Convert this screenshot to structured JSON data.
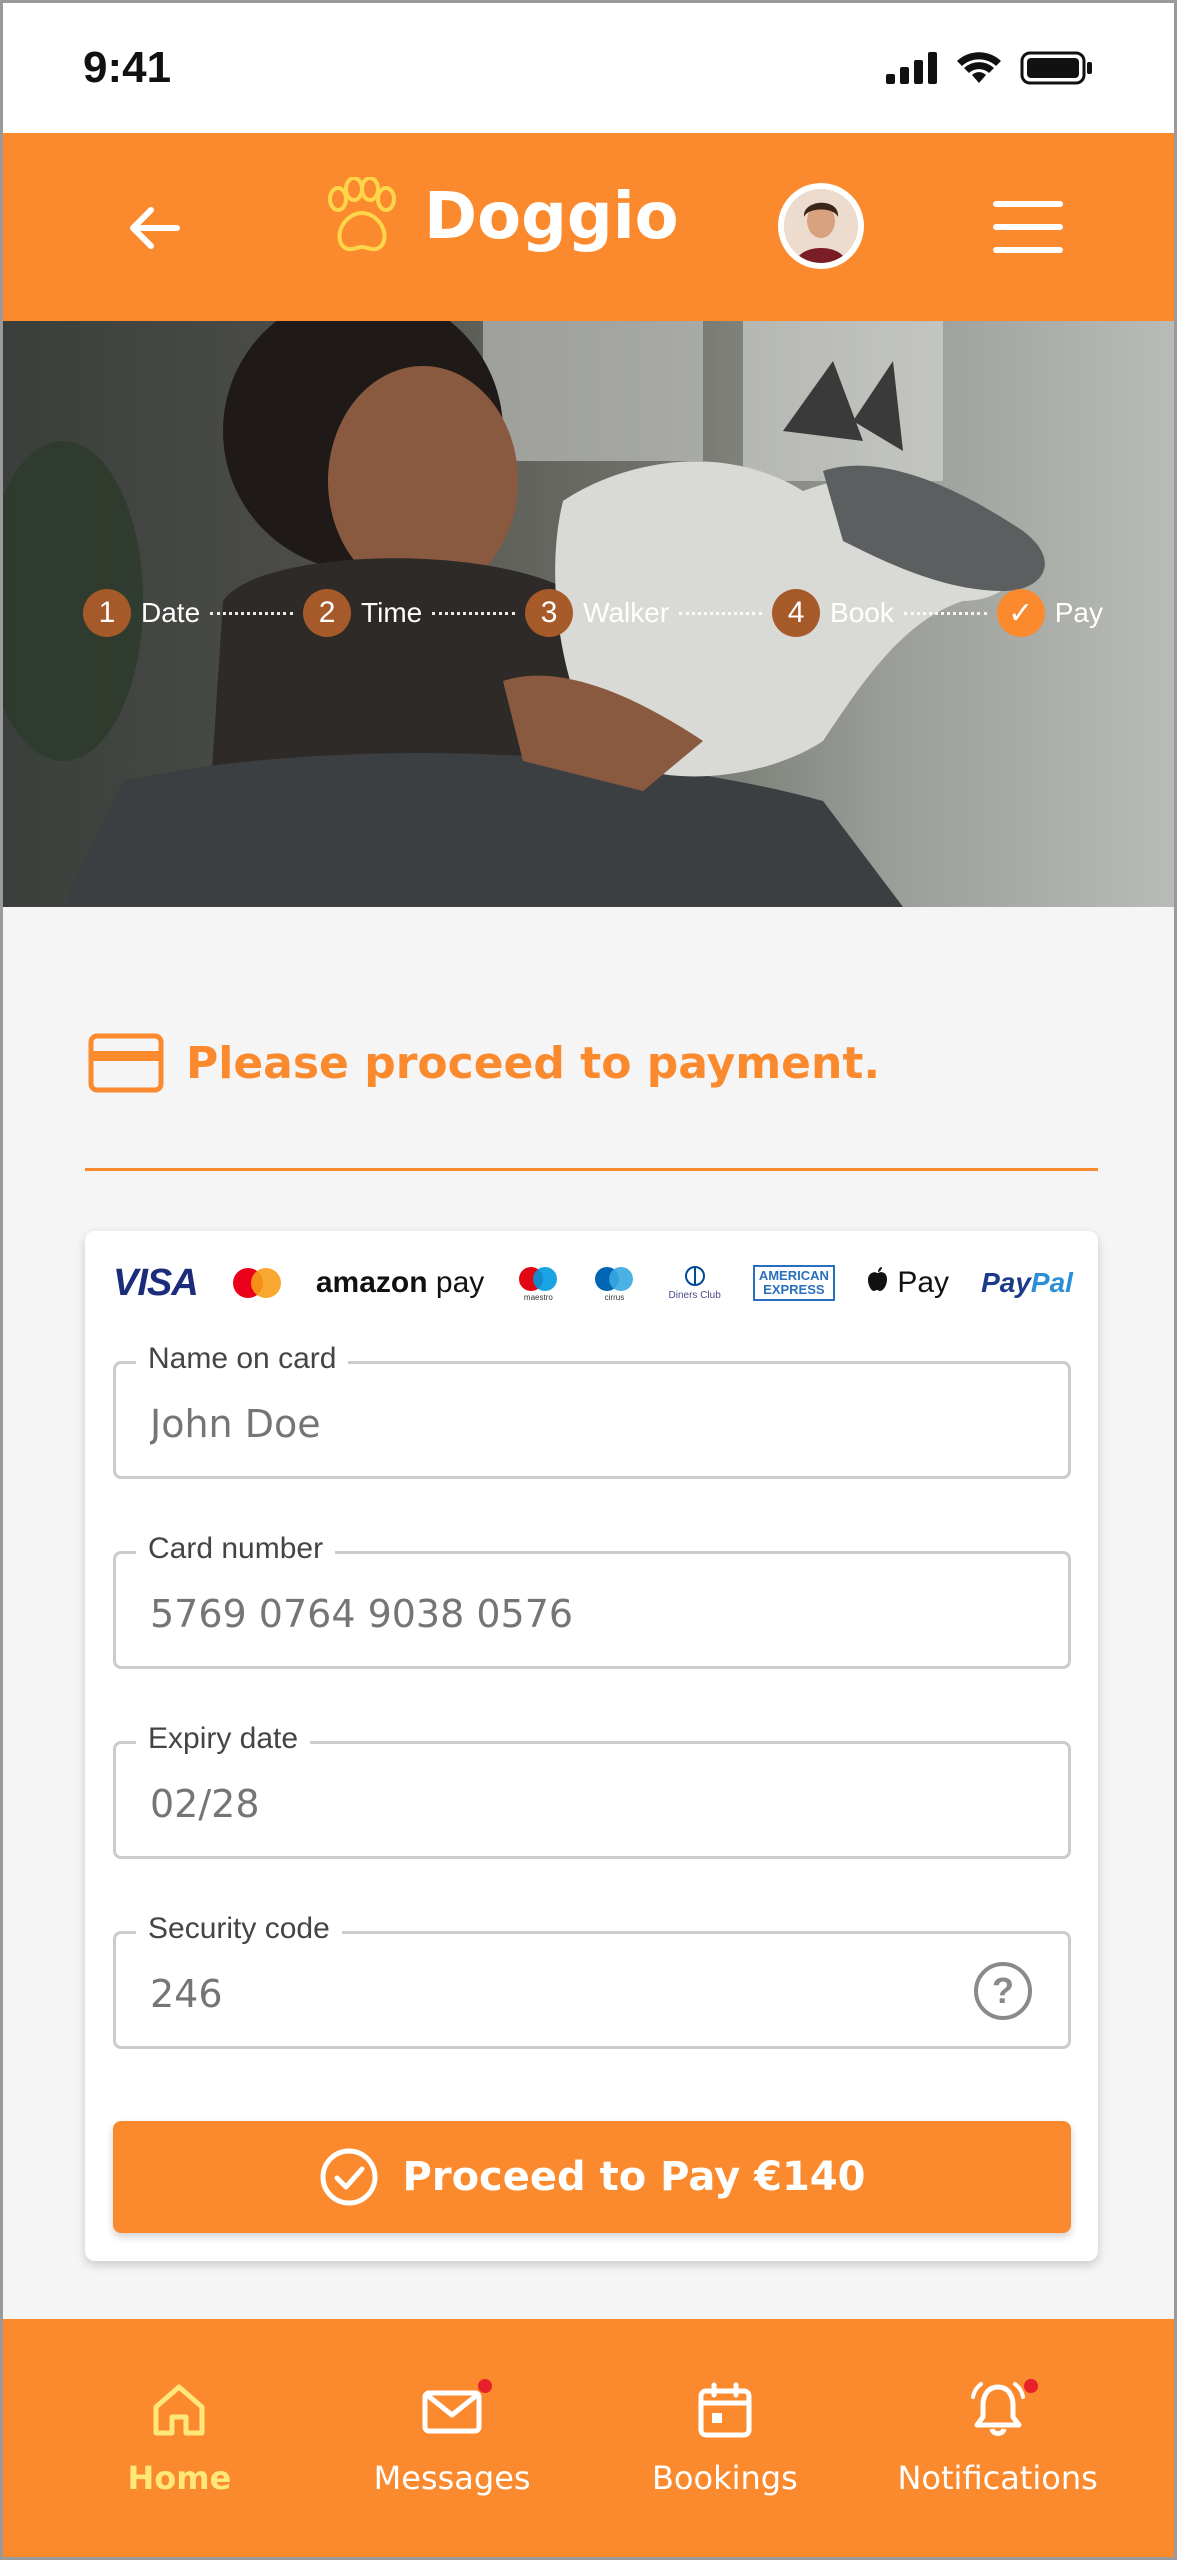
{
  "status": {
    "time": "9:41"
  },
  "header": {
    "brand": "Doggio"
  },
  "stepper": {
    "steps": [
      {
        "num": "1",
        "label": "Date"
      },
      {
        "num": "2",
        "label": "Time"
      },
      {
        "num": "3",
        "label": "Walker"
      },
      {
        "num": "4",
        "label": "Book"
      },
      {
        "num": "✓",
        "label": "Pay"
      }
    ]
  },
  "payment": {
    "heading": "Please proceed to payment.",
    "logos": {
      "visa": "VISA",
      "amazon_bold": "amazon",
      "amazon_pay": " pay",
      "applepay": " Pay",
      "paypal_pay": "Pay",
      "paypal_pal": "Pal",
      "amex_1": "AMERICAN",
      "amex_2": "EXPRESS",
      "diners": "Diners Club",
      "maestro": "maestro",
      "cirrus": "cirrus"
    },
    "fields": {
      "name": {
        "label": "Name on card",
        "placeholder": "John Doe"
      },
      "card": {
        "label": "Card number",
        "placeholder": "5769 0764 9038 0576"
      },
      "expiry": {
        "label": "Expiry date",
        "placeholder": "02/28"
      },
      "cvc": {
        "label": "Security code",
        "placeholder": "246"
      }
    },
    "button": "Proceed to Pay €140"
  },
  "nav": {
    "home": "Home",
    "messages": "Messages",
    "bookings": "Bookings",
    "notifications": "Notifications"
  },
  "colors": {
    "accent": "#fb8a2e",
    "active_nav": "#ffe77a",
    "badge": "#e8202a"
  }
}
